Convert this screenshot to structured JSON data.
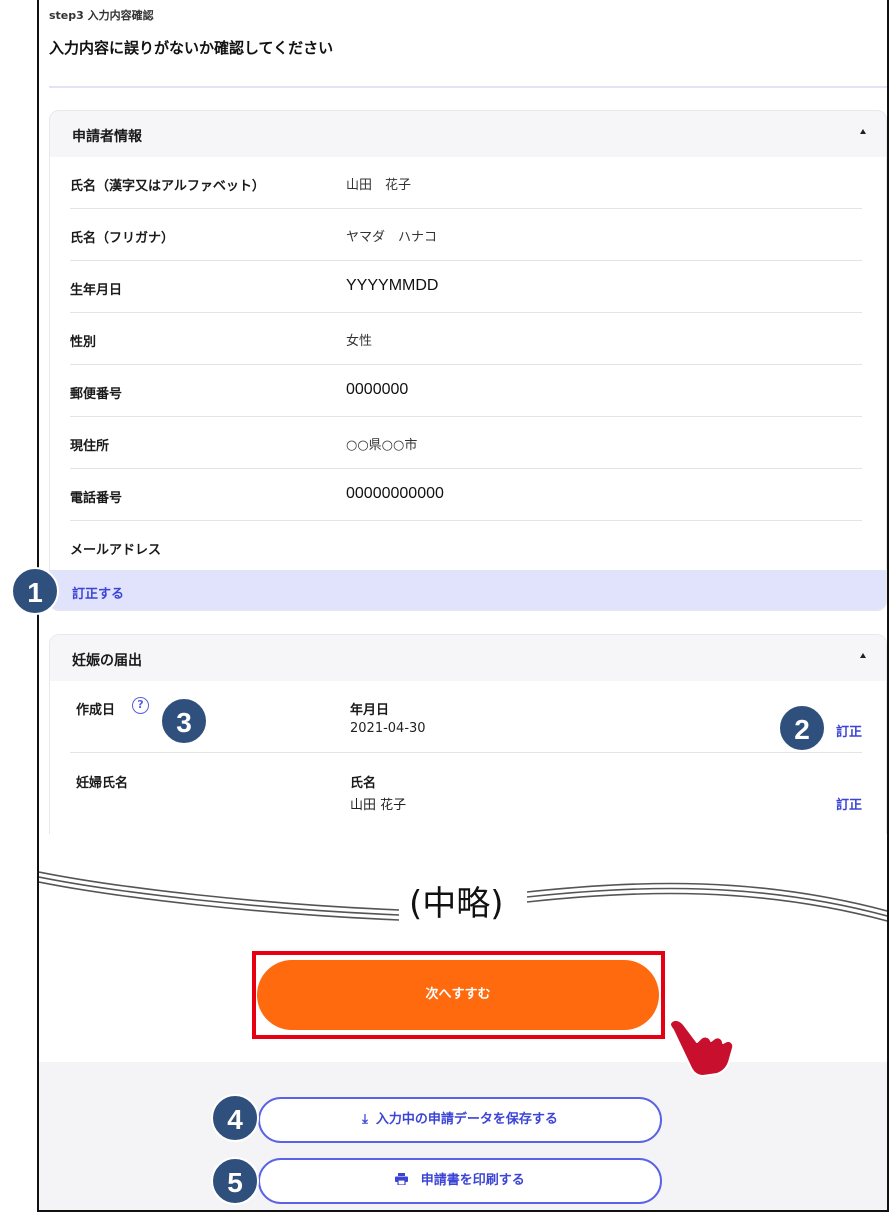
{
  "header": {
    "step_label": "step3 入力内容確認",
    "title": "入力内容に誤りがないか確認してください"
  },
  "applicant": {
    "heading": "申請者情報",
    "rows": [
      {
        "label": "氏名（漢字又はアルファベット）",
        "value": "山田　花子"
      },
      {
        "label": "氏名（フリガナ）",
        "value": "ヤマダ　ハナコ"
      },
      {
        "label": "生年月日",
        "value": "YYYYMMDD"
      },
      {
        "label": "性別",
        "value": "女性"
      },
      {
        "label": "郵便番号",
        "value": "0000000"
      },
      {
        "label": "現住所",
        "value": "○○県○○市"
      },
      {
        "label": "電話番号",
        "value": "00000000000"
      },
      {
        "label": "メールアドレス",
        "value": ""
      }
    ],
    "correct_link": "訂正する"
  },
  "pregnancy": {
    "heading": "妊娠の届出",
    "rows": [
      {
        "label": "作成日",
        "sub_label": "年月日",
        "value": "2021-04-30",
        "fix": "訂正"
      },
      {
        "label": "妊婦氏名",
        "sub_label": "氏名",
        "value": "山田 花子",
        "fix": "訂正"
      }
    ]
  },
  "omitted_text": "(中略)",
  "actions": {
    "next_label": "次へすすむ",
    "save_label": "入力中の申請データを保存する",
    "print_label": "申請書を印刷する"
  },
  "badges": [
    "1",
    "2",
    "3",
    "4",
    "5"
  ],
  "colors": {
    "accent": "#3b44d6",
    "cta": "#ff6a0f",
    "highlight_border": "#e60012",
    "badge": "#2f4f7d"
  }
}
